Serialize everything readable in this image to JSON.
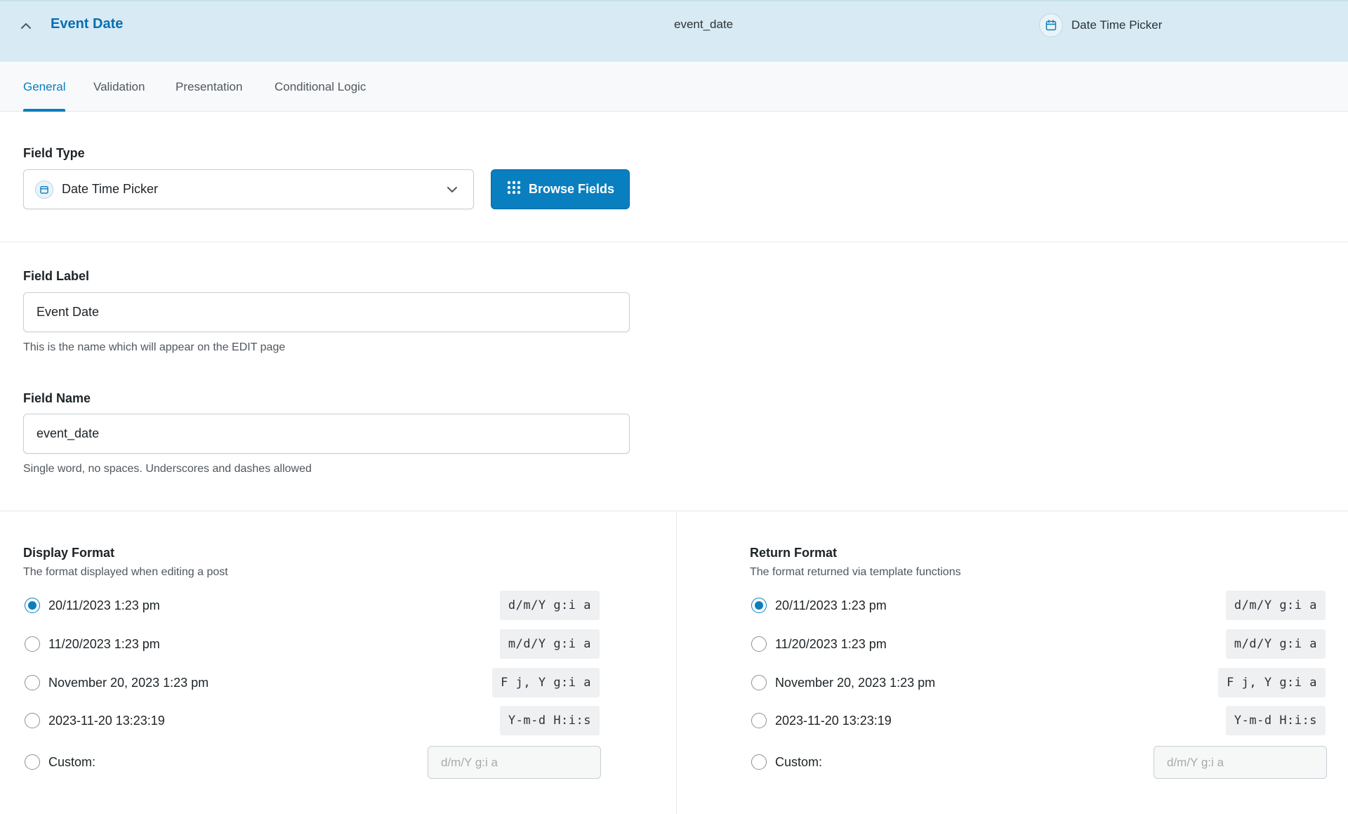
{
  "header": {
    "title": "Event Date",
    "key": "event_date",
    "type": "Date Time Picker",
    "type_icon": "calendar-icon",
    "collapse_icon": "chevron-up-icon"
  },
  "tabs": [
    {
      "label": "General",
      "active": true
    },
    {
      "label": "Validation",
      "active": false
    },
    {
      "label": "Presentation",
      "active": false
    },
    {
      "label": "Conditional Logic",
      "active": false
    }
  ],
  "field_type": {
    "label": "Field Type",
    "value": "Date Time Picker",
    "icon": "calendar-icon",
    "browse_button": "Browse Fields",
    "browse_icon": "grid-icon"
  },
  "field_label": {
    "label": "Field Label",
    "value": "Event Date",
    "instructions": "This is the name which will appear on the EDIT page"
  },
  "field_name": {
    "label": "Field Name",
    "value": "event_date",
    "instructions": "Single word, no spaces. Underscores and dashes allowed"
  },
  "display_format": {
    "label": "Display Format",
    "instructions": "The format displayed when editing a post",
    "options": [
      {
        "label": "20/11/2023 1:23 pm",
        "code": "d/m/Y g:i a",
        "checked": true
      },
      {
        "label": "11/20/2023 1:23 pm",
        "code": "m/d/Y g:i a",
        "checked": false
      },
      {
        "label": "November 20, 2023 1:23 pm",
        "code": "F j, Y g:i a",
        "checked": false
      },
      {
        "label": "2023-11-20 13:23:19",
        "code": "Y-m-d H:i:s",
        "checked": false
      }
    ],
    "custom_label": "Custom:",
    "custom_placeholder": "d/m/Y g:i a"
  },
  "return_format": {
    "label": "Return Format",
    "instructions": "The format returned via template functions",
    "options": [
      {
        "label": "20/11/2023 1:23 pm",
        "code": "d/m/Y g:i a",
        "checked": true
      },
      {
        "label": "11/20/2023 1:23 pm",
        "code": "m/d/Y g:i a",
        "checked": false
      },
      {
        "label": "November 20, 2023 1:23 pm",
        "code": "F j, Y g:i a",
        "checked": false
      },
      {
        "label": "2023-11-20 13:23:19",
        "code": "Y-m-d H:i:s",
        "checked": false
      }
    ],
    "custom_label": "Custom:",
    "custom_placeholder": "d/m/Y g:i a"
  },
  "colors": {
    "header_bg": "#d8ebf4",
    "accent": "#0a7fbf",
    "title": "#0a6eb4"
  }
}
